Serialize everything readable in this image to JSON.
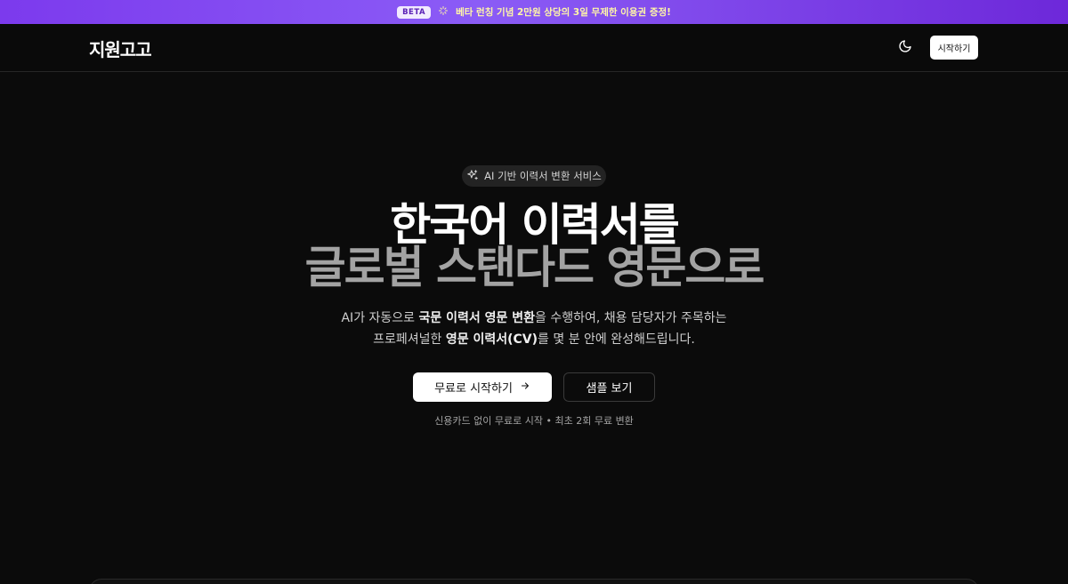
{
  "banner": {
    "badge": "BETA",
    "icon": "sparkle-icon",
    "text": "베타 런칭 기념 2만원 상당의 3일 무제한 이용권 증정!"
  },
  "nav": {
    "logo": "지원고고",
    "theme_icon": "moon-icon",
    "start_label": "시작하기"
  },
  "hero": {
    "pill_icon": "sparkle-icon",
    "pill_label": "AI 기반 이력서 변환 서비스",
    "headline_line1": "한국어 이력서를",
    "headline_line2": "글로벌 스탠다드 영문으로",
    "desc_line1": {
      "a": "AI가 자동으로 ",
      "b": "국문 이력서 영문 변환",
      "c": "을 수행하여, 채용 담당자가 주목하는"
    },
    "desc_line2": {
      "a": "프로페셔널한 ",
      "b": "영문 이력서(CV)",
      "c": "를 몇 분 안에 완성해드립니다."
    },
    "cta_primary": "무료로 시작하기",
    "cta_primary_icon": "arrow-right-icon",
    "cta_secondary": "샘플 보기",
    "note": "신용카드 없이 무료로 시작 • 최초 2회 무료 변환"
  },
  "colors": {
    "background": "#0b0b0b",
    "banner_gradient_start": "#7c3aed",
    "banner_text": "#fff6a8",
    "headline_primary": "#ffffff",
    "headline_secondary": "#a3a3a3"
  }
}
